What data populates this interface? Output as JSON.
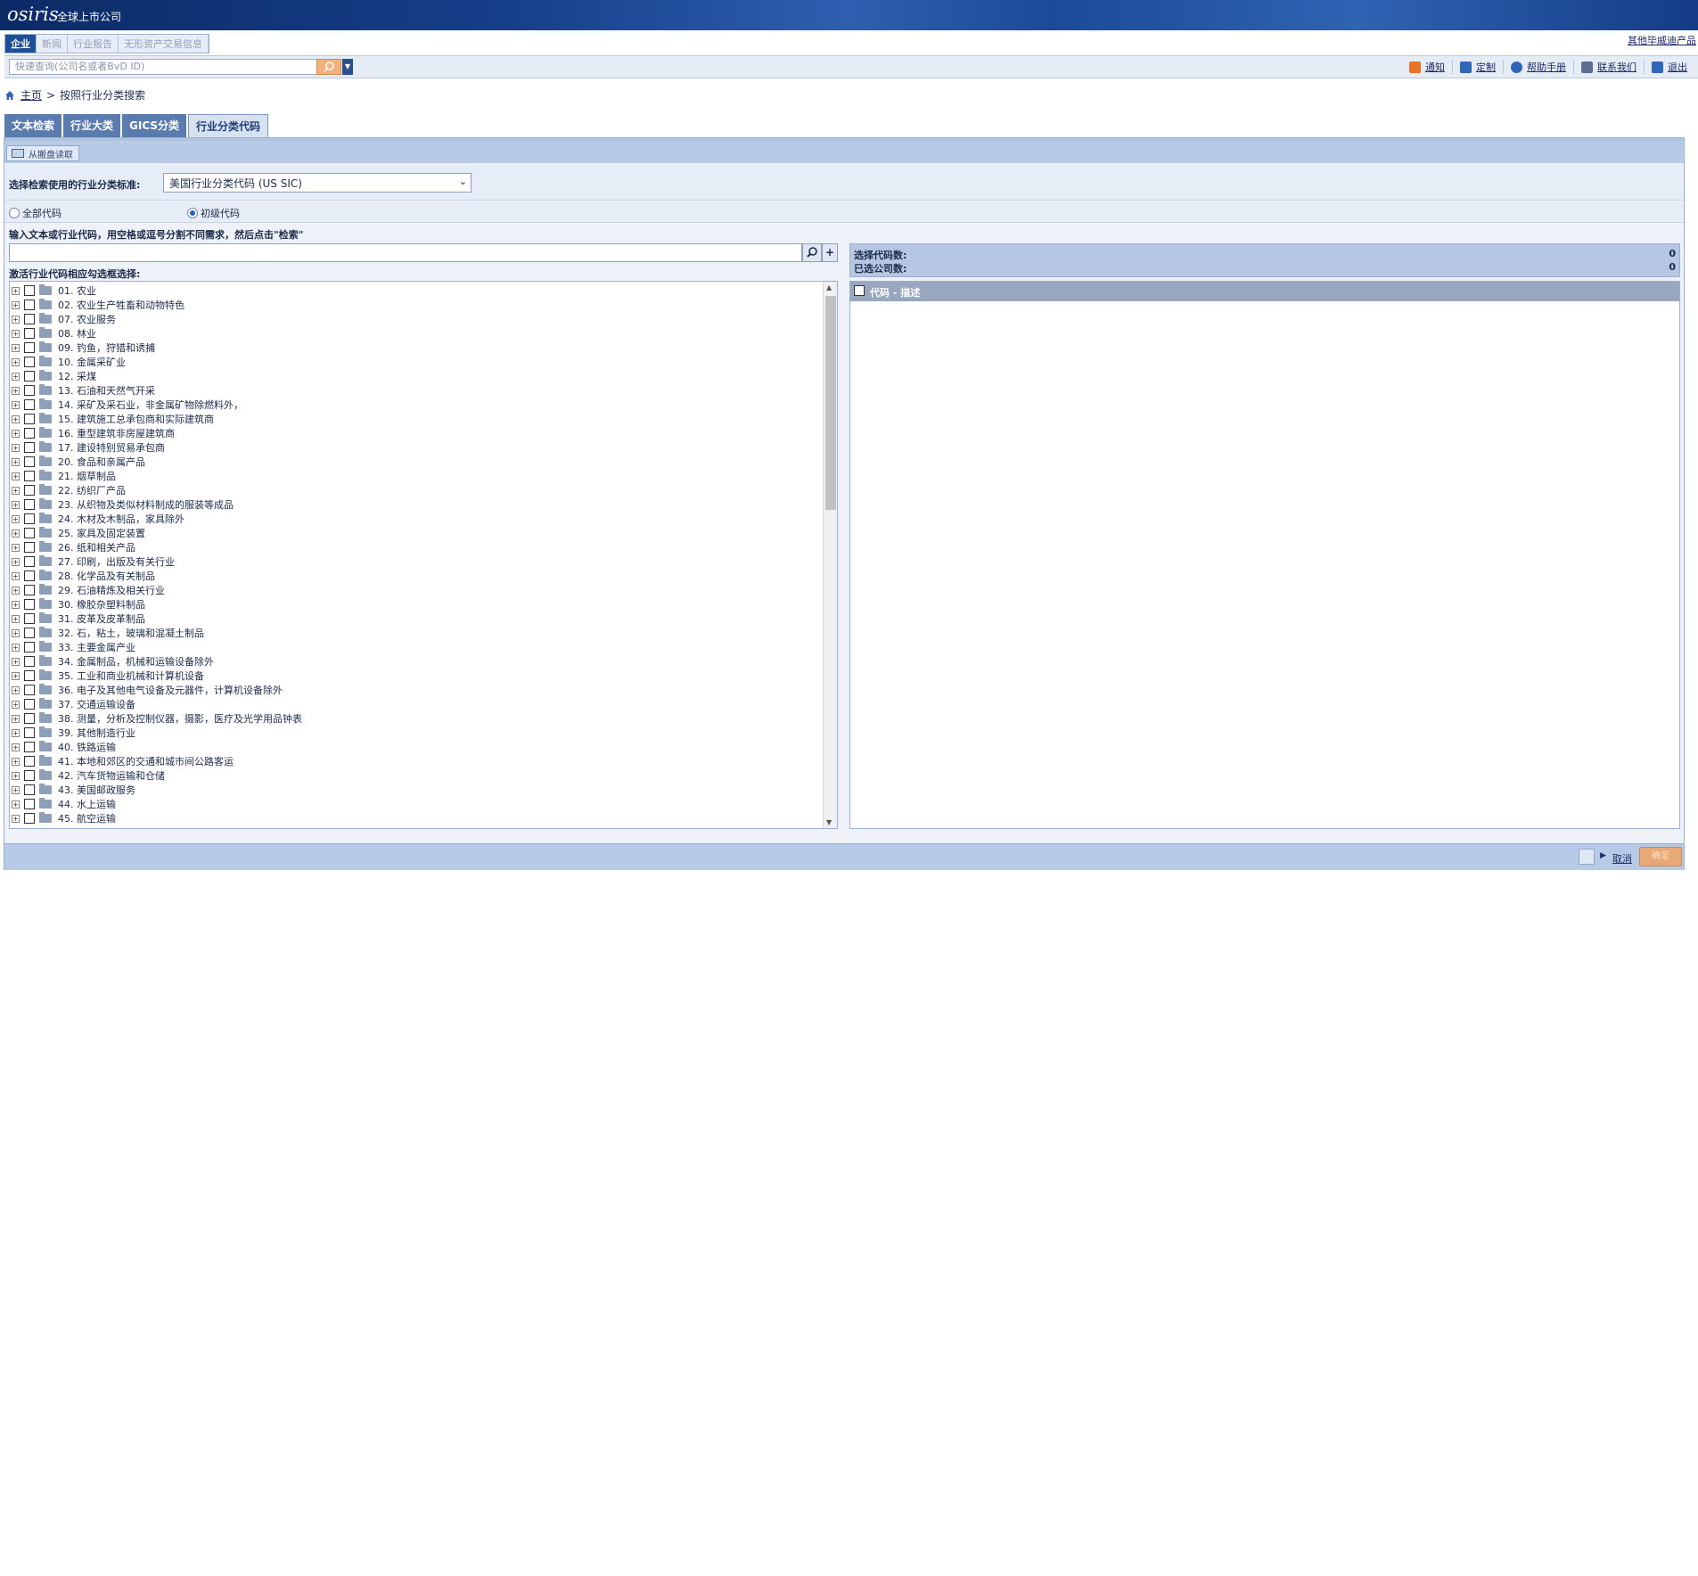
{
  "header": {
    "logo": "osiris",
    "title": "全球上市公司",
    "other_products": "其他毕威迪产品"
  },
  "main_tabs": [
    "企业",
    "新闻",
    "行业报告",
    "无形资产交易信息"
  ],
  "search": {
    "placeholder": "快速查询(公司名或者BvD ID)"
  },
  "toplinks": [
    {
      "label": "通知",
      "icon": "notify-icon",
      "color": "#e8742a"
    },
    {
      "label": "定制",
      "icon": "customize-icon",
      "color": "#2f66b8"
    },
    {
      "label": "帮助手册",
      "icon": "help-icon",
      "color": "#2f66b8"
    },
    {
      "label": "联系我们",
      "icon": "contact-icon",
      "color": "#5b6f93"
    },
    {
      "label": "退出",
      "icon": "logout-icon",
      "color": "#2f66b8"
    }
  ],
  "breadcrumb": {
    "home": "主页",
    "separator": ">",
    "current": "按照行业分类搜索"
  },
  "sub_tabs": [
    "文本检索",
    "行业大类",
    "GICS分类",
    "行业分类代码"
  ],
  "toolstrip": {
    "load_from_library": "从搬盘读取"
  },
  "standard": {
    "label": "选择检索使用的行业分类标准:",
    "selected": "美国行业分类代码 (US SIC)"
  },
  "radios": [
    {
      "label": "全部代码",
      "checked": false
    },
    {
      "label": "初级代码",
      "checked": true
    }
  ],
  "instructions": "输入文本或行业代码，用空格或逗号分割不同需求，然后点击\"检索\"",
  "tree_label": "激活行业代码相应勾选框选择:",
  "tree_items": [
    "01. 农业",
    "02. 农业生产牲畜和动物特色",
    "07. 农业服务",
    "08. 林业",
    "09. 钓鱼，狩猎和诱捕",
    "10. 金属采矿业",
    "12. 采煤",
    "13. 石油和天然气开采",
    "14. 采矿及采石业，非金属矿物除燃料外，",
    "15. 建筑施工总承包商和实际建筑商",
    "16. 重型建筑非房屋建筑商",
    "17. 建设特别贸易承包商",
    "20. 食品和亲属产品",
    "21. 烟草制品",
    "22. 纺织厂产品",
    "23. 从织物及类似材料制成的服装等成品",
    "24. 木材及木制品，家具除外",
    "25. 家具及固定装置",
    "26. 纸和相关产品",
    "27. 印刷，出版及有关行业",
    "28. 化学品及有关制品",
    "29. 石油精炼及相关行业",
    "30. 橡胶杂塑料制品",
    "31. 皮革及皮革制品",
    "32. 石，粘土，玻璃和混凝土制品",
    "33. 主要金属产业",
    "34. 金属制品，机械和运输设备除外",
    "35. 工业和商业机械和计算机设备",
    "36. 电子及其他电气设备及元器件，计算机设备除外",
    "37. 交通运输设备",
    "38. 测量，分析及控制仪器，摄影，医疗及光学用品钟表",
    "39. 其他制造行业",
    "40. 铁路运输",
    "41. 本地和郊区的交通和城市间公路客运",
    "42. 汽车货物运输和仓储",
    "43. 美国邮政服务",
    "44. 水上运输",
    "45. 航空运输"
  ],
  "stats": {
    "selected_codes_label": "选择代码数:",
    "selected_codes_value": "0",
    "selected_companies_label": "已选公司数:",
    "selected_companies_value": "0"
  },
  "result": {
    "header": "代码 - 描述"
  },
  "footer": {
    "cancel": "取消",
    "ok": "确定"
  }
}
